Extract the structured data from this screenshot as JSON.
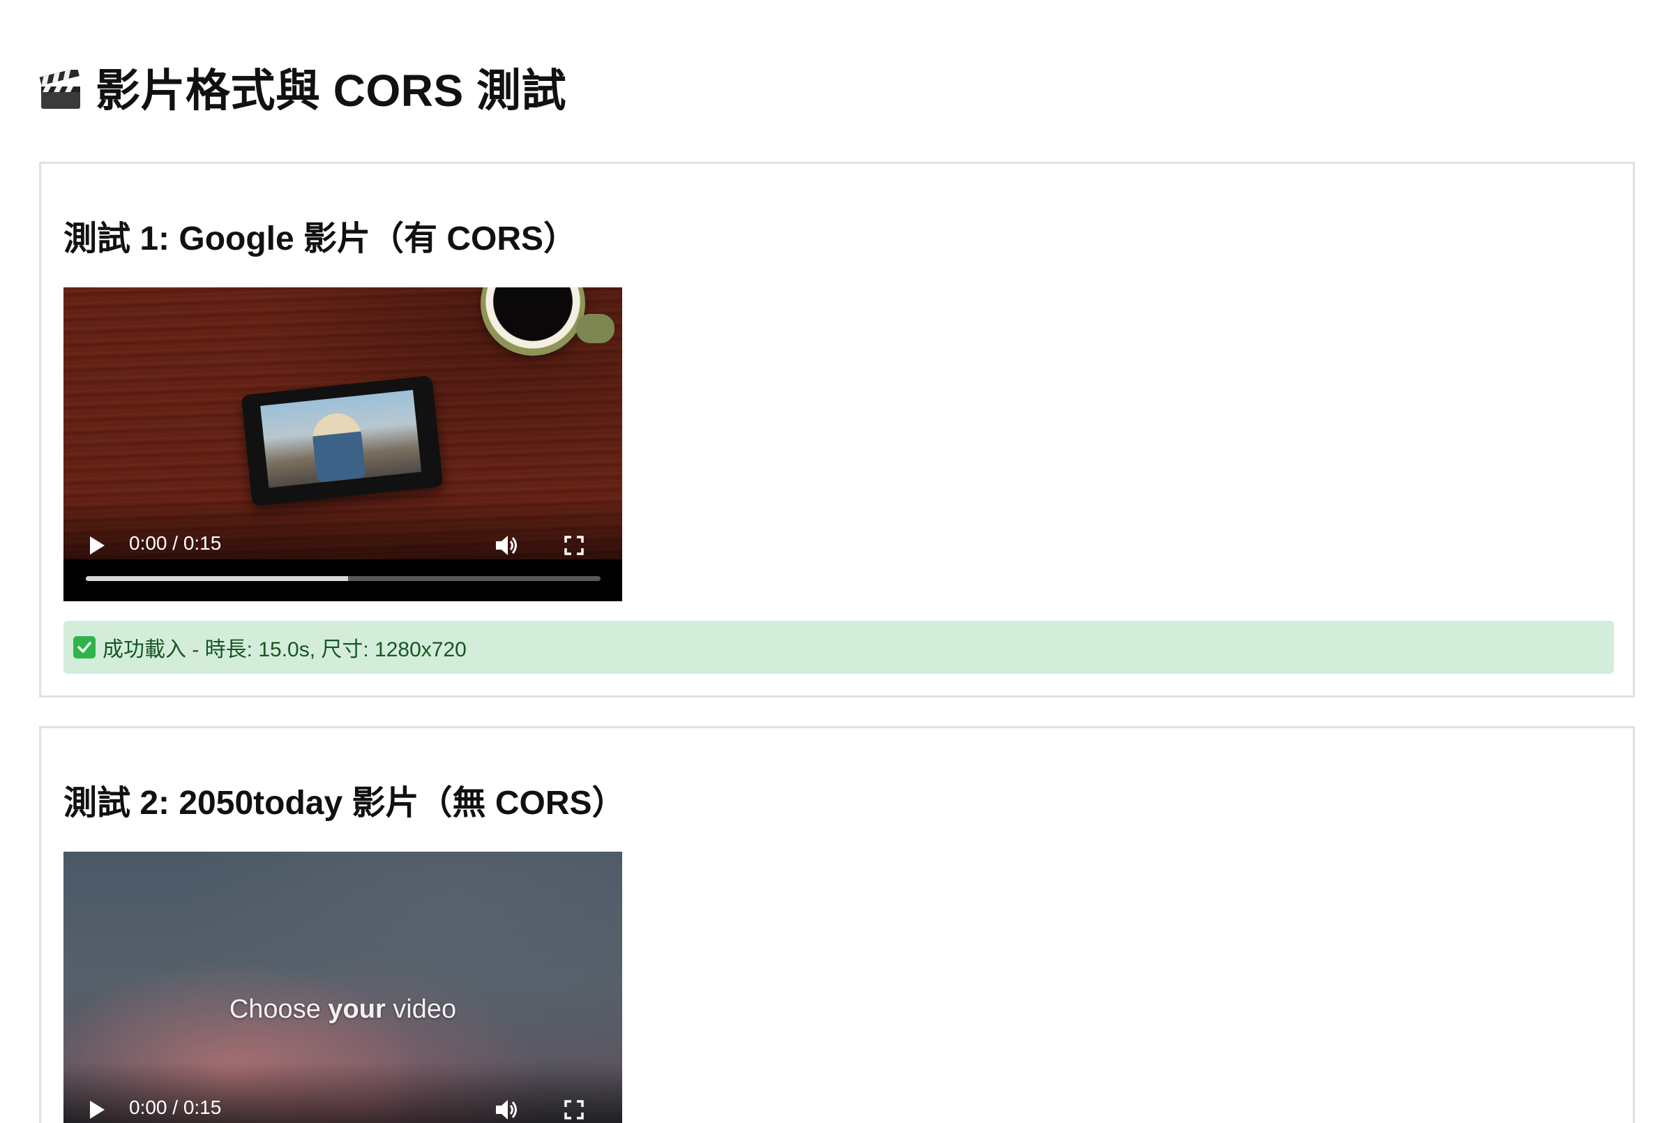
{
  "page": {
    "title": "影片格式與 CORS 測試",
    "title_icon": "clapper-board-icon"
  },
  "tests": [
    {
      "title": "測試 1: Google 影片（有 CORS）",
      "video": {
        "time": "0:00 / 0:15",
        "progress_buffered": 0.51
      },
      "status": {
        "icon": "check-mark-icon",
        "text": "成功載入 - 時長: 15.0s, 尺寸: 1280x720",
        "color": "#155724",
        "background": "#d4edda"
      }
    },
    {
      "title": "測試 2: 2050today 影片（無 CORS）",
      "video": {
        "overlay_prefix": "Choose ",
        "overlay_bold": "your",
        "overlay_suffix": " video",
        "time": "0:00 / 0:15"
      }
    }
  ]
}
